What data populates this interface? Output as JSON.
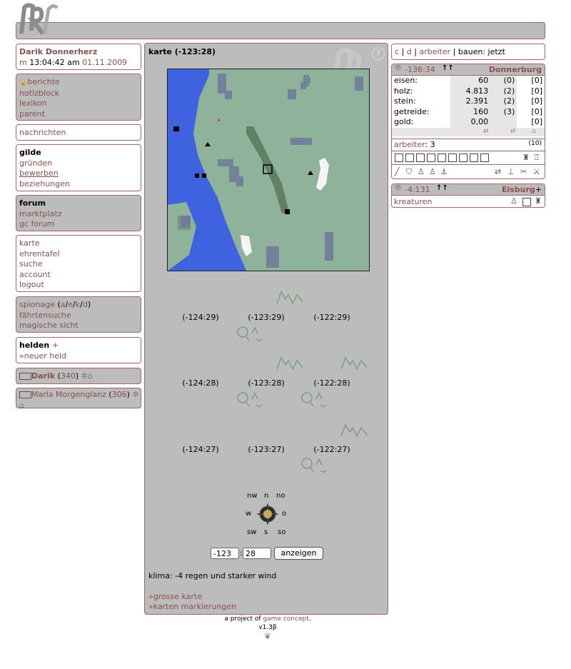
{
  "player": {
    "name": "Darik Donnerherz",
    "time_prefix": "m",
    "time": "13:04:42 am",
    "date": "01.11.2009"
  },
  "nav": {
    "box1": [
      "berichte",
      "notizblock",
      "lexikon",
      "parent"
    ],
    "box2": [
      "nachrichten"
    ],
    "gilde": {
      "title": "gilde",
      "items": [
        "gründen",
        "bewerben",
        "beziehungen"
      ]
    },
    "forum": {
      "title": "forum",
      "items": [
        "marktplatz",
        "gc forum"
      ]
    },
    "box5": [
      "karte",
      "ehrentafel",
      "suche",
      "account",
      "logout"
    ],
    "spionage": {
      "label": "spionage",
      "open": "(",
      "links": [
        "a",
        "e",
        "k",
        "d"
      ],
      "close": ")"
    },
    "box6_rest": [
      "fährtensuche",
      "magische sicht"
    ],
    "helden": {
      "title": "helden",
      "plus": "+",
      "new": "»neuer held"
    },
    "heroes": [
      {
        "name": "Darik",
        "level": "340"
      },
      {
        "name": "Marla Morgenglanz",
        "level": "306"
      }
    ]
  },
  "map": {
    "title": "karte (-123:28)",
    "help": "?",
    "grid": [
      [
        "(-124:29)",
        "(-123:29)",
        "(-122:29)"
      ],
      [
        "(-124:28)",
        "(-123:28)",
        "(-122:28)"
      ],
      [
        "(-124:27)",
        "(-123:27)",
        "(-122:27)"
      ]
    ],
    "compass": {
      "nw": "nw",
      "n": "n",
      "no": "no",
      "w": "w",
      "o": "o",
      "sw": "sw",
      "s": "s",
      "so": "so"
    },
    "x_value": "-123",
    "separator": ":",
    "y_value": "28",
    "show_button": "anzeigen",
    "climate": "klima: -4 regen und starker wind",
    "links": [
      "»grosse karte",
      "»karten markierungen"
    ]
  },
  "right": {
    "topnav": {
      "c": "c",
      "sep1": "|",
      "d": "d",
      "sep2": "|",
      "arbeiter": "arbeiter",
      "sep3": "|",
      "bauen": "bauen: jetzt"
    },
    "city1": {
      "coords": "-136:34",
      "name": "Donnerburg",
      "resources": [
        {
          "name": "eisen:",
          "amount": "60",
          "rate": "(0)",
          "extra": "[0]"
        },
        {
          "name": "holz:",
          "amount": "4.813",
          "rate": "(2)",
          "extra": "[0]"
        },
        {
          "name": "stein:",
          "amount": "2.391",
          "rate": "(2)",
          "extra": "[0]"
        },
        {
          "name": "getreide:",
          "amount": "160",
          "rate": "(3)",
          "extra": "[0]"
        },
        {
          "name": "gold:",
          "amount": "0,00",
          "rate": "",
          "extra": "[0]"
        }
      ],
      "workers_label": "arbeiter",
      "workers_value": ": 3",
      "workers_total": "(10)"
    },
    "city2": {
      "coords": "-4:131",
      "name": "Eisburg",
      "plus": "+",
      "item": "kreaturen"
    }
  },
  "footer": {
    "prefix": "a project of",
    "link": "game concept",
    "suffix": ".",
    "version": "v1.3β"
  },
  "colors": {
    "accent": "#8a5050",
    "panel": "#bcbcbc",
    "border": "#a06a6a",
    "water": "#3f63e0",
    "grass": "#8fb39a"
  }
}
